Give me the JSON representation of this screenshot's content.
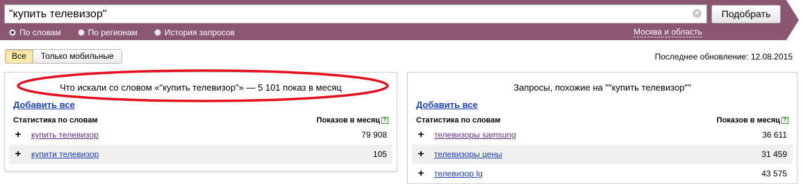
{
  "search": {
    "query": "\"купить телевизор\"",
    "clear_glyph": "×",
    "submit_label": "Подобрать"
  },
  "modes": [
    {
      "label": "По словам",
      "checked": true
    },
    {
      "label": "По регионам",
      "checked": false
    },
    {
      "label": "История запросов",
      "checked": false
    }
  ],
  "region": "Москва и область",
  "filter": {
    "all_label": "Все",
    "mobile_label": "Только мобильные"
  },
  "last_update": "Последнее обновление: 12.08.2015",
  "left_panel": {
    "title": "Что искали со словом «\"купить телевизор\"» — 5 101 показ в месяц",
    "add_all": "Добавить все",
    "col_words": "Статистика по словам",
    "col_shows": "Показов в месяц",
    "help_glyph": "?",
    "rows": [
      {
        "keyword": "купить телевизор",
        "count": "79 908"
      },
      {
        "keyword": "купити телевизор",
        "count": "105"
      }
    ]
  },
  "right_panel": {
    "title": "Запросы, похожие на \"\"купить телевизор\"\"",
    "add_all": "Добавить все",
    "col_words": "Статистика по словам",
    "col_shows": "Показов в месяц",
    "help_glyph": "?",
    "rows": [
      {
        "keyword": "телевизоры samsung",
        "count": "36 611"
      },
      {
        "keyword": "телевизоры цены",
        "count": "31 459"
      },
      {
        "keyword": "телевизор lg",
        "count": "43 575"
      }
    ]
  },
  "colors": {
    "banner": "#8b5670",
    "link": "#1a3dc1",
    "visited_link": "#6b2b8c",
    "highlight_ellipse": "#e3101d",
    "active_filter": "#ffe9a7"
  },
  "icons": {
    "clear": "clear-icon",
    "help": "help-icon",
    "add": "plus-icon"
  }
}
